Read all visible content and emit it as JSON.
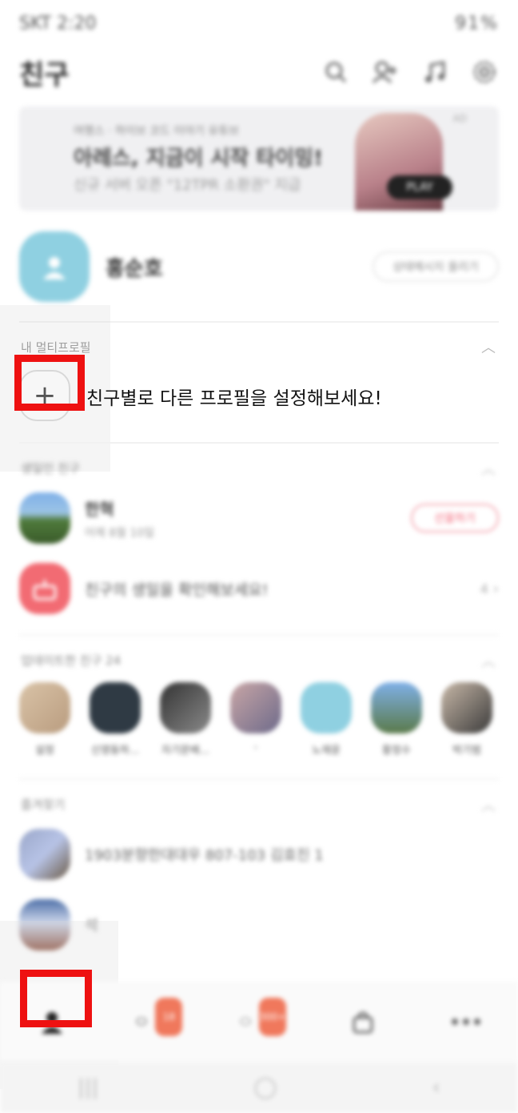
{
  "status_bar": {
    "left": "SKT 2:20",
    "right": "91%"
  },
  "header": {
    "title": "친구",
    "icons": [
      "search-icon",
      "add-friend-icon",
      "music-icon",
      "settings-icon"
    ]
  },
  "banner": {
    "small": "여행스 · 하이브 코드 이야기 유튜브",
    "headline": "아레스, 지금이 시작 타이밍!",
    "sub": "신규 서버 오픈 \"12TPR 소환권\" 지급",
    "play_label": "PLAY",
    "ad_label": "AD"
  },
  "my_profile": {
    "name": "홍순호",
    "button": "상태메시지 올리기"
  },
  "multi_profile": {
    "section_title": "내 멀티프로필",
    "prompt": "친구별로 다른 프로필을 설정해보세요!"
  },
  "birthday": {
    "section_title": "생일인 친구",
    "friend": {
      "name": "한혁",
      "date": "어제 8월 10일",
      "button": "선물하기"
    },
    "check": {
      "label": "친구의 생일을 확인해보세요!",
      "count": "4"
    }
  },
  "updated": {
    "section_title": "업데이트한 친구 24",
    "items": [
      {
        "label": "설정"
      },
      {
        "label": "신영동하..."
      },
      {
        "label": "자기문배..."
      },
      {
        "label": "-"
      },
      {
        "label": "노재윤"
      },
      {
        "label": "황정수"
      },
      {
        "label": "박기범"
      }
    ]
  },
  "favorites": {
    "section_title": "즐겨찾기",
    "items": [
      {
        "label": "1903분향한대대우 807-103 김효진 1"
      },
      {
        "label": "석"
      }
    ]
  },
  "tabbar": {
    "items": [
      "friends-icon",
      "chats-icon",
      "openchat-icon",
      "shopping-icon",
      "more-icon"
    ],
    "badges": {
      "chats": "18",
      "openchat": "300+"
    }
  },
  "colors": {
    "highlight": "#ee1111",
    "accent": "#f0785c"
  }
}
